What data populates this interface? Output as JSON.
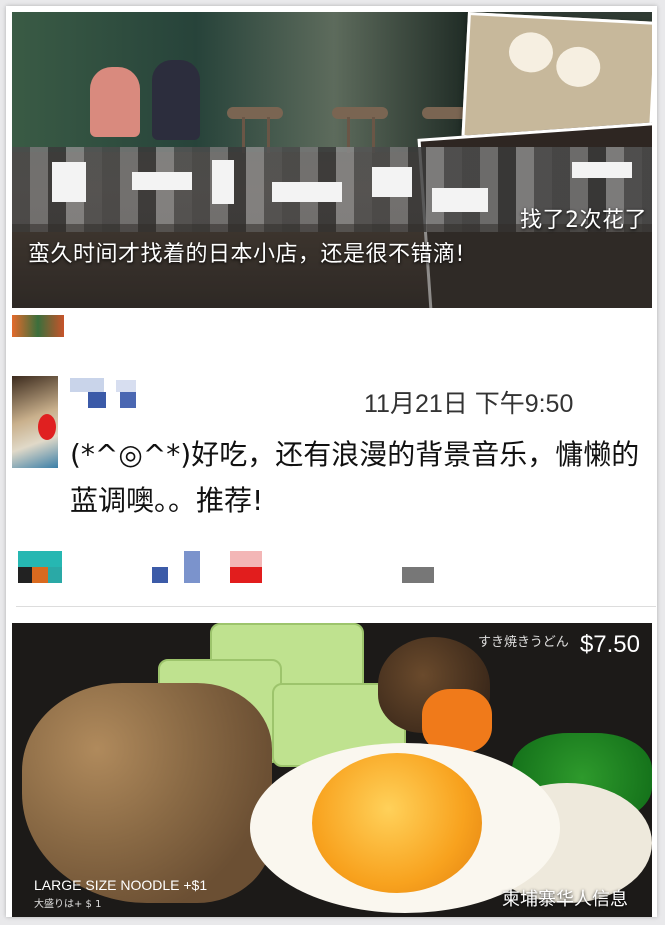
{
  "top_photo": {
    "caption_line1": "找了2次花了",
    "caption_line2": "蛮久时间才找着的日本小店，还是很不错滴!"
  },
  "post": {
    "timestamp": "11月21日 下午9:50",
    "text": "(*^◎^*)好吃，还有浪漫的背景音乐，慵懒的蓝调噢。。推荐!"
  },
  "food_photo": {
    "jp_label": "すき焼きうどん",
    "price": "$7.50",
    "noodle_label": "LARGE SIZE NOODLE +$1",
    "noodle_sub": "大盛りは+ $ 1",
    "watermark": "柬埔寨华人信息"
  }
}
